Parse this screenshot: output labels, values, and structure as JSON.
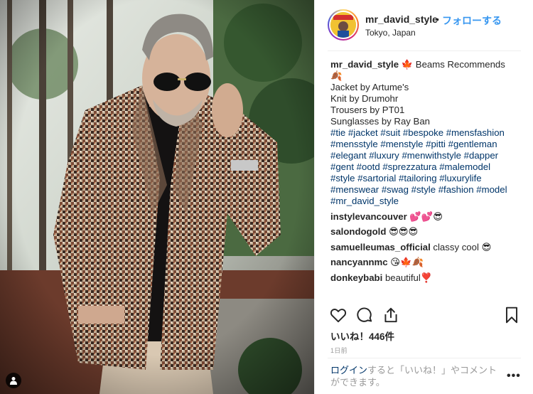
{
  "post": {
    "username": "mr_david_style",
    "follow_separator": "•",
    "follow_label": "フォローする",
    "location": "Tokyo, Japan",
    "caption": {
      "username": "mr_david_style",
      "first_line_text": " 🍁  Beams Recommends",
      "second_line": "🍂",
      "lines": [
        "Jacket by Artume's",
        "Knit by Drumohr",
        "Trousers by PT01",
        "Sunglasses by Ray Ban"
      ],
      "hashtag_lines": [
        "#tie #jacket #suit #bespoke #mensfashion",
        "#mensstyle #menstyle #pitti #gentleman",
        "#elegant #luxury #menwithstyle #dapper",
        "#gent #ootd #sprezzatura #malemodel",
        "#style #sartorial #tailoring #luxurylife",
        "#menswear #swag #style #fashion #model",
        "#mr_david_style"
      ]
    },
    "comments": [
      {
        "user": "instylevancouver",
        "text": "💕💕😎"
      },
      {
        "user": "salondogold",
        "text": "😎😎😎"
      },
      {
        "user": "samuelleumas_official",
        "text": "classy cool 😎"
      },
      {
        "user": "nancyannmc",
        "text": "😘🍁🍂"
      },
      {
        "user": "donkeybabi",
        "text": "beautiful❣️"
      }
    ],
    "likes": "いいね！446件",
    "timestamp": "1日前",
    "login_link": "ログイン",
    "login_rest": "すると「いいね！」やコメントができます。",
    "more_label": "•••"
  },
  "icons": {
    "like": "heart-icon",
    "comment": "comment-bubble-icon",
    "share": "share-icon",
    "save": "bookmark-icon",
    "tag": "user-tag-icon",
    "more": "more-options-icon"
  },
  "colors": {
    "follow_blue": "#3897f0",
    "hashtag_blue": "#003569",
    "text_dark": "#262626",
    "text_muted": "#999999"
  }
}
